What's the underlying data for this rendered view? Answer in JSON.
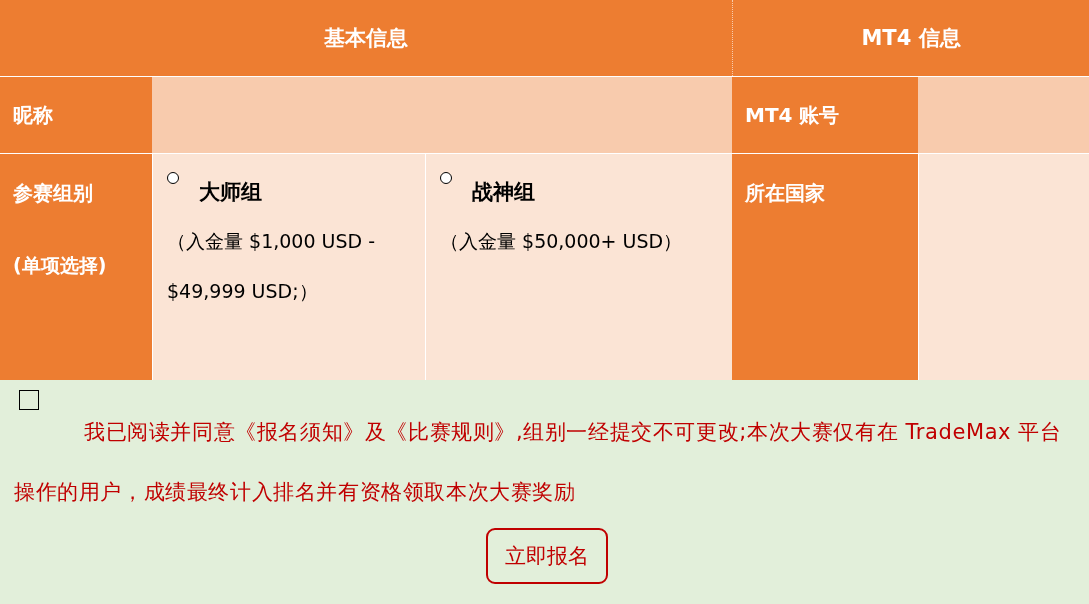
{
  "header": {
    "basic_info": "基本信息",
    "mt4_info": "MT4 信息"
  },
  "nickname": {
    "label": "昵称"
  },
  "mt4_account": {
    "label": "MT4 账号"
  },
  "group": {
    "label": "参赛组别",
    "hint": "(单项选择)",
    "options": [
      {
        "name": "大师组",
        "detail": "（入金量  $1,000 USD - $49,999 USD;）",
        "selected": false
      },
      {
        "name": "战神组",
        "detail": "（入金量  $50,000+ USD）",
        "selected": false
      }
    ]
  },
  "country": {
    "label": "所在国家"
  },
  "agreement": {
    "checked": false,
    "text": "我已阅读并同意《报名须知》及《比赛规则》,组别一经提交不可更改;本次大赛仅有在 TradeMax 平台操作的用户，成绩最终计入排名并有资格领取本次大赛奖励"
  },
  "submit_button": "立即报名"
}
